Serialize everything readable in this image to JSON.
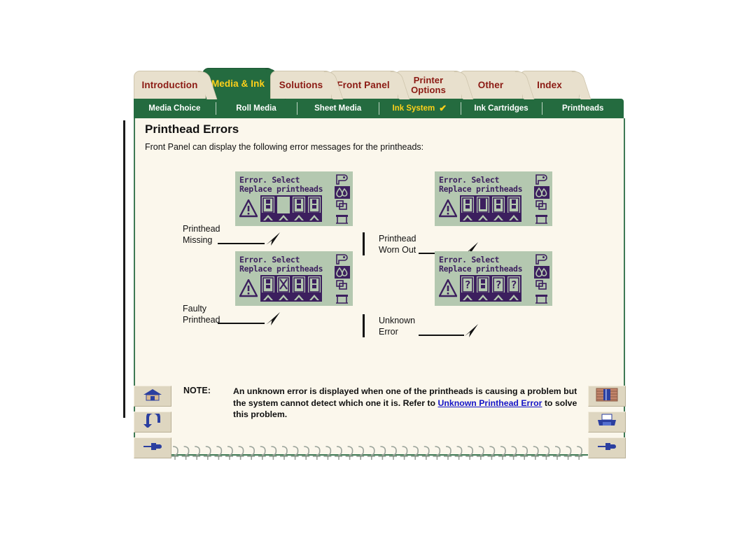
{
  "tabs": [
    {
      "label": "Introduction",
      "active": false,
      "name": "tab-introduction"
    },
    {
      "label": "Media & Ink",
      "active": true,
      "name": "tab-media-ink"
    },
    {
      "label": "Solutions",
      "active": false,
      "name": "tab-solutions"
    },
    {
      "label": "Front Panel",
      "active": false,
      "name": "tab-front-panel"
    },
    {
      "label": "Printer Options",
      "active": false,
      "name": "tab-printer-options"
    },
    {
      "label": "Other",
      "active": false,
      "name": "tab-other"
    },
    {
      "label": "Index",
      "active": false,
      "name": "tab-index"
    }
  ],
  "subtabs": [
    {
      "label": "Media Choice",
      "selected": false
    },
    {
      "label": "Roll Media",
      "selected": false
    },
    {
      "label": "Sheet Media",
      "selected": false
    },
    {
      "label": "Ink System",
      "selected": true,
      "check": "✔"
    },
    {
      "label": "Ink Cartridges",
      "selected": false
    },
    {
      "label": "Printheads",
      "selected": false
    }
  ],
  "page": {
    "title": "Printhead Errors",
    "intro": "Front Panel can display the following error messages for the printheads:"
  },
  "panels": [
    {
      "id": "printhead-missing",
      "lcd_line1": "Error. Select",
      "lcd_line2": "Replace printheads",
      "caption_line1": "Printhead",
      "caption_line2": "Missing",
      "slot_state": [
        "normal",
        "empty",
        "normal",
        "normal"
      ],
      "pointer_slot": 2
    },
    {
      "id": "printhead-worn-out",
      "lcd_line1": "Error. Select",
      "lcd_line2": "Replace printheads",
      "caption_line1": "Printhead",
      "caption_line2": "Worn Out",
      "slot_state": [
        "normal",
        "worn",
        "normal",
        "normal"
      ],
      "pointer_slot": 2
    },
    {
      "id": "faulty-printhead",
      "lcd_line1": "Error. Select",
      "lcd_line2": "Replace printheads",
      "caption_line1": "Faulty",
      "caption_line2": "Printhead",
      "slot_state": [
        "normal",
        "faulty",
        "normal",
        "normal"
      ],
      "pointer_slot": 2
    },
    {
      "id": "unknown-error",
      "lcd_line1": "Error. Select",
      "lcd_line2": "Replace printheads",
      "caption_line1": "Unknown",
      "caption_line2": "Error",
      "slot_state": [
        "unknown",
        "normal",
        "unknown",
        "unknown"
      ],
      "pointer_slot": 2
    }
  ],
  "lcd_icons": [
    "roll-media-icon",
    "ink-drops-icon",
    "sheet-media-icon",
    "printer-icon"
  ],
  "note": {
    "label": "NOTE:",
    "text_before": "An unknown error is displayed when one of the printheads is causing a problem but the system cannot detect which one it is. Refer to ",
    "link": "Unknown Printhead Error",
    "text_after": " to solve this problem."
  },
  "left_nav": [
    {
      "name": "home-button",
      "icon": "home-icon"
    },
    {
      "name": "back-button",
      "icon": "back-arrow-icon"
    },
    {
      "name": "forward-button",
      "icon": "pointing-hand-icon"
    }
  ],
  "right_nav": [
    {
      "name": "bookshelf-button",
      "icon": "bookshelf-icon"
    },
    {
      "name": "print-button",
      "icon": "printer-icon"
    },
    {
      "name": "next-button",
      "icon": "pointing-hand-icon"
    }
  ],
  "colors": {
    "green": "#246b3f",
    "tab_cream": "#e8e0cd",
    "tab_text": "#8b1a13",
    "accent_yellow": "#ffd11a",
    "page_bg": "#fbf7ec",
    "lcd_bg": "#b4c8b0",
    "lcd_fg": "#3c1f5e",
    "link": "#1414c8"
  }
}
